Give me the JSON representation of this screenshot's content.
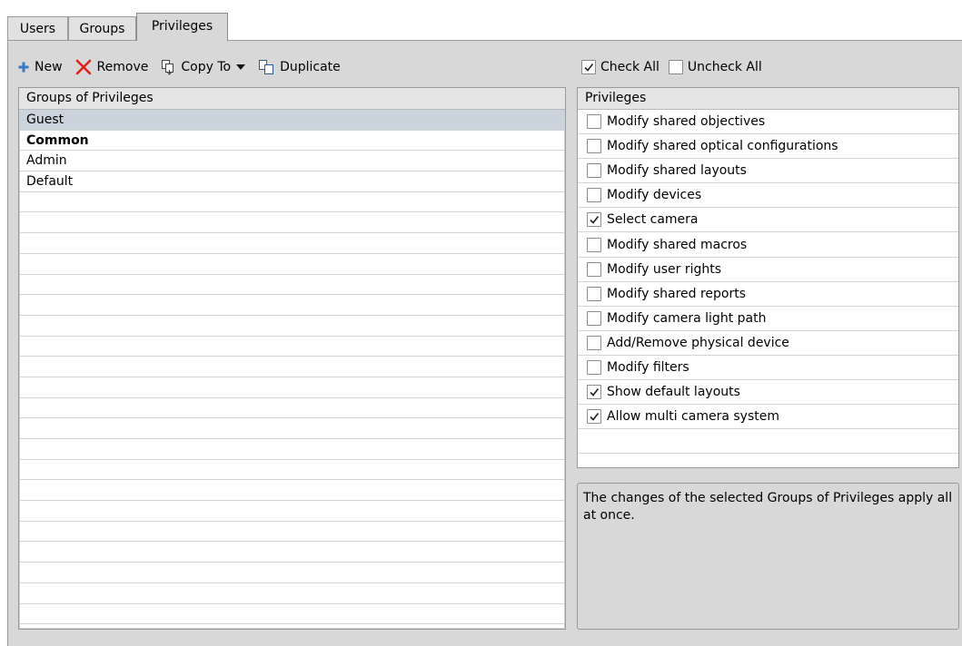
{
  "tabs": [
    {
      "label": "Users"
    },
    {
      "label": "Groups"
    },
    {
      "label": "Privileges"
    }
  ],
  "toolbar": {
    "new_label": "New",
    "remove_label": "Remove",
    "copy_to_label": "Copy To",
    "duplicate_label": "Duplicate"
  },
  "checkbar": {
    "check_all_label": "Check All",
    "check_all_checked": true,
    "uncheck_all_label": "Uncheck All",
    "uncheck_all_checked": false
  },
  "groups_list": {
    "header": "Groups of Privileges",
    "items": [
      {
        "label": "Guest",
        "selected": true,
        "bold": false
      },
      {
        "label": "Common",
        "selected": false,
        "bold": true
      },
      {
        "label": "Admin",
        "selected": false,
        "bold": false
      },
      {
        "label": "Default",
        "selected": false,
        "bold": false
      }
    ]
  },
  "privileges_list": {
    "header": "Privileges",
    "items": [
      {
        "label": "Modify shared objectives",
        "checked": false
      },
      {
        "label": "Modify shared optical configurations",
        "checked": false
      },
      {
        "label": "Modify shared layouts",
        "checked": false
      },
      {
        "label": "Modify devices",
        "checked": false
      },
      {
        "label": "Select camera",
        "checked": true
      },
      {
        "label": "Modify shared macros",
        "checked": false
      },
      {
        "label": "Modify user rights",
        "checked": false
      },
      {
        "label": "Modify shared reports",
        "checked": false
      },
      {
        "label": "Modify camera light path",
        "checked": false
      },
      {
        "label": "Add/Remove physical device",
        "checked": false
      },
      {
        "label": "Modify filters",
        "checked": false
      },
      {
        "label": "Show default layouts",
        "checked": true
      },
      {
        "label": "Allow multi camera system",
        "checked": true
      }
    ]
  },
  "description": {
    "text": "The changes of the selected Groups of Privileges apply all at once."
  },
  "colors": {
    "panel_bg": "#d8d8d8",
    "selected_row": "#cbd3dc",
    "new_icon": "#3a78c3",
    "remove_icon": "#e0211a"
  }
}
